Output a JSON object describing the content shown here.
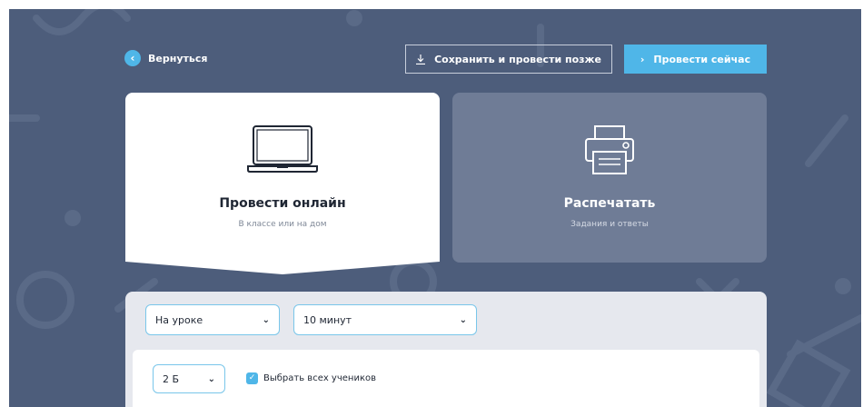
{
  "header": {
    "back_label": "Вернуться",
    "save_later_label": "Сохранить и провести позже",
    "run_now_label": "Провести сейчас"
  },
  "cards": {
    "online": {
      "title": "Провести онлайн",
      "subtitle": "В классе или на дом",
      "icon": "laptop-icon",
      "selected": true
    },
    "print": {
      "title": "Распечатать",
      "subtitle": "Задания и ответы",
      "icon": "printer-icon",
      "selected": false
    }
  },
  "settings": {
    "mode_select": "На уроке",
    "duration_select": "10 минут",
    "class_select": "2 Б",
    "select_all_students_label": "Выбрать всех учеников",
    "select_all_checked": true
  },
  "colors": {
    "background": "#4d5d7b",
    "accent": "#4fb6e8",
    "card_selected": "#ffffff",
    "card_unselected": "#6f7c96",
    "panel": "#e6e8ee"
  }
}
